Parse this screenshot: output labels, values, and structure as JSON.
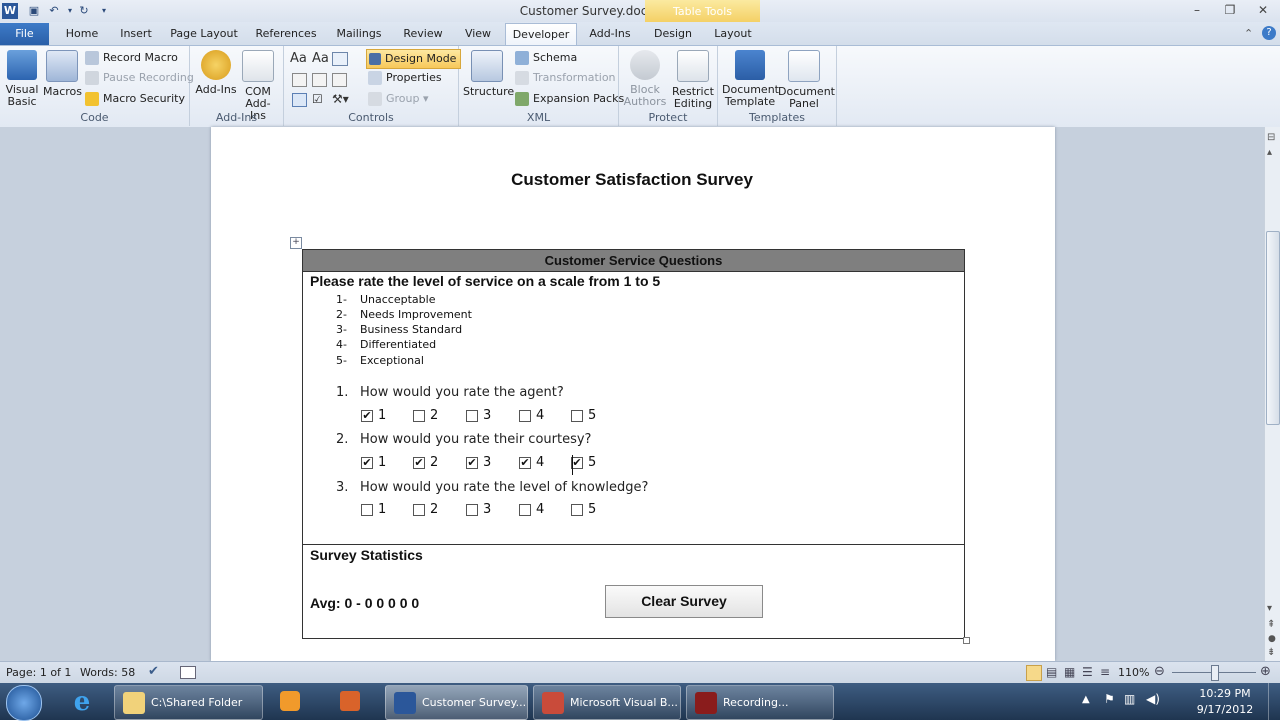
{
  "window": {
    "title": "Customer Survey.docm - Microsoft Word",
    "context_tab": "Table Tools"
  },
  "tabs": [
    "File",
    "Home",
    "Insert",
    "Page Layout",
    "References",
    "Mailings",
    "Review",
    "View",
    "Developer",
    "Add-Ins",
    "Design",
    "Layout"
  ],
  "ribbon": {
    "code": {
      "label": "Code",
      "visual_basic": "Visual Basic",
      "macros": "Macros",
      "record_macro": "Record Macro",
      "pause_recording": "Pause Recording",
      "macro_security": "Macro Security"
    },
    "addins": {
      "label": "Add-Ins",
      "add_ins": "Add-Ins",
      "com_add_ins": "COM Add-Ins"
    },
    "controls": {
      "label": "Controls",
      "design_mode": "Design Mode",
      "properties": "Properties",
      "group": "Group"
    },
    "xml": {
      "label": "XML",
      "structure": "Structure",
      "schema": "Schema",
      "transformation": "Transformation",
      "expansion_packs": "Expansion Packs"
    },
    "protect": {
      "label": "Protect",
      "block_authors": "Block Authors",
      "restrict_editing": "Restrict Editing"
    },
    "templates": {
      "label": "Templates",
      "document_template": "Document Template",
      "document_panel": "Document Panel"
    }
  },
  "document": {
    "title": "Customer Satisfaction Survey",
    "table_header": "Customer Service Questions",
    "instruction": "Please rate the level of service on a scale from 1 to 5",
    "scale": [
      {
        "num": "1-",
        "text": "Unacceptable"
      },
      {
        "num": "2-",
        "text": "Needs Improvement"
      },
      {
        "num": "3-",
        "text": "Business Standard"
      },
      {
        "num": "4-",
        "text": "Differentiated"
      },
      {
        "num": "5-",
        "text": "Exceptional"
      }
    ],
    "questions": [
      {
        "num": "1.",
        "text": "How would you rate the agent?",
        "checked": [
          true,
          false,
          false,
          false,
          false
        ]
      },
      {
        "num": "2.",
        "text": "How would you rate their courtesy?",
        "checked": [
          true,
          true,
          true,
          true,
          true
        ]
      },
      {
        "num": "3.",
        "text": "How would you rate the level of knowledge?",
        "checked": [
          false,
          false,
          false,
          false,
          false
        ]
      }
    ],
    "options": [
      "1",
      "2",
      "3",
      "4",
      "5"
    ],
    "stats_title": "Survey Statistics",
    "avg_text": "Avg: 0 - 0 0 0 0 0",
    "clear_button": "Clear Survey"
  },
  "status": {
    "page": "Page: 1 of 1",
    "words": "Words: 58",
    "zoom": "110%"
  },
  "taskbar": {
    "items": [
      "C:\\Shared Folder",
      "Customer Survey....",
      "Microsoft Visual B...",
      "Recording..."
    ],
    "time": "10:29 PM",
    "date": "9/17/2012"
  },
  "colors": {
    "file_tab": "#2a5fa8",
    "table_header_bg": "#7f7f7f",
    "taskbar": "#1f3550",
    "table_tools": "#f4cf63"
  }
}
